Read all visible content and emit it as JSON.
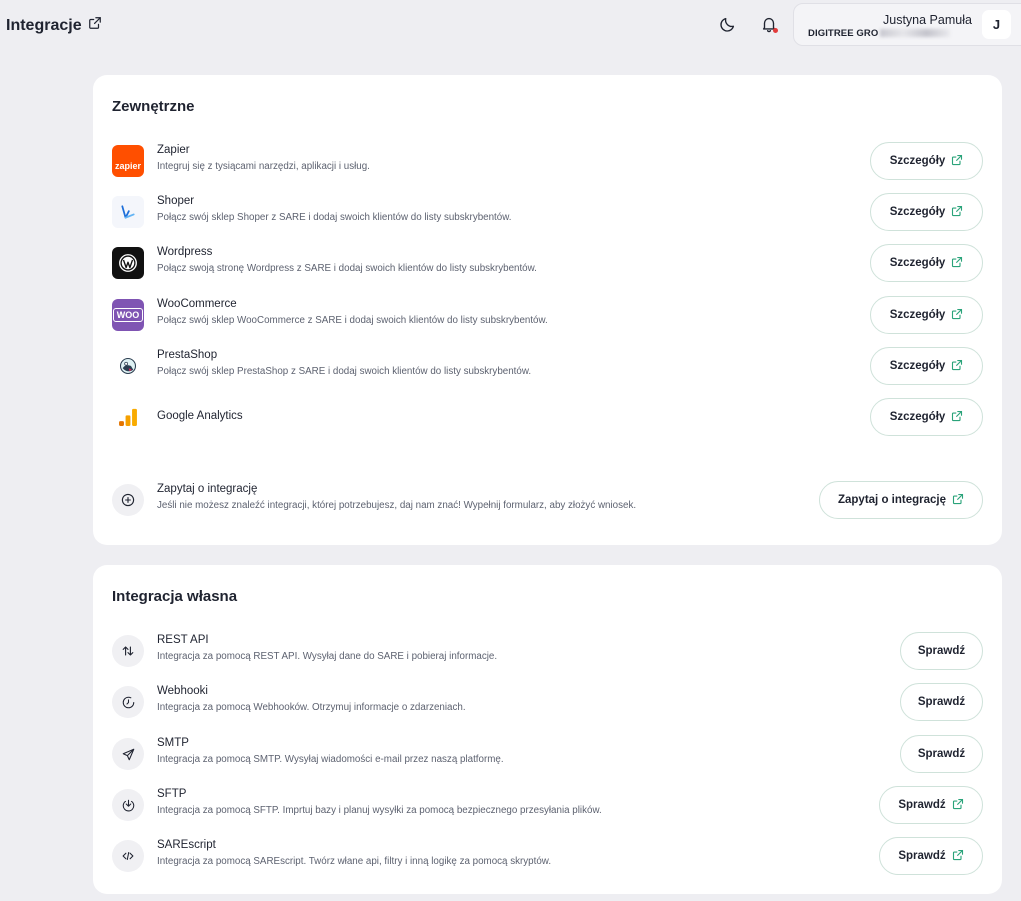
{
  "header": {
    "title": "Integracje",
    "user_name": "Justyna Pamuła",
    "user_org": "DIGITREE GRO",
    "avatar_letter": "J"
  },
  "external": {
    "title": "Zewnętrzne",
    "button_label": "Szczegóły",
    "items": [
      {
        "name": "Zapier",
        "desc": "Integruj się z tysiącami narzędzi, aplikacji i usług.",
        "icon": "zapier-logo",
        "logo_text": "zapier"
      },
      {
        "name": "Shoper",
        "desc": "Połącz swój sklep Shoper z SARE i dodaj swoich klientów do listy subskrybentów.",
        "icon": "shoper-logo"
      },
      {
        "name": "Wordpress",
        "desc": "Połącz swoją stronę Wordpress z SARE i dodaj swoich klientów do listy subskrybentów.",
        "icon": "wordpress-logo"
      },
      {
        "name": "WooCommerce",
        "desc": "Połącz swój sklep WooCommerce z SARE i dodaj swoich klientów do listy subskrybentów.",
        "icon": "woocommerce-logo",
        "logo_text": "WOO"
      },
      {
        "name": "PrestaShop",
        "desc": "Połącz swój sklep PrestaShop z SARE i dodaj swoich klientów do listy subskrybentów.",
        "icon": "prestashop-logo"
      },
      {
        "name": "Google Analytics",
        "desc": "",
        "icon": "google-analytics-logo"
      }
    ],
    "request": {
      "name": "Zapytaj o integrację",
      "desc": "Jeśli nie możesz znaleźć integracji, której potrzebujesz, daj nam znać! Wypełnij formularz, aby złożyć wniosek.",
      "button_label": "Zapytaj o integrację",
      "icon": "plus-circle-icon"
    }
  },
  "own": {
    "title": "Integracja własna",
    "button_label": "Sprawdź",
    "items": [
      {
        "name": "REST API",
        "desc": "Integracja za pomocą REST API. Wysyłaj dane do SARE i pobieraj informacje.",
        "icon": "arrows-up-down-icon",
        "external": false
      },
      {
        "name": "Webhooki",
        "desc": "Integracja za pomocą Webhooków. Otrzymuj informacje o zdarzeniach.",
        "icon": "clock-icon",
        "external": false
      },
      {
        "name": "SMTP",
        "desc": "Integracja za pomocą SMTP. Wysyłaj wiadomości e-mail przez naszą platformę.",
        "icon": "send-icon",
        "external": false
      },
      {
        "name": "SFTP",
        "desc": "Integracja za pomocą SFTP. Imprtuj bazy i planuj wysyłki za pomocą bezpiecznego przesyłania plików.",
        "icon": "download-circle-icon",
        "external": true
      },
      {
        "name": "SAREscript",
        "desc": "Integracja za pomocą SAREscript. Twórz włane api, filtry i inną logikę za pomocą skryptów.",
        "icon": "code-icon",
        "external": true
      }
    ]
  },
  "colors": {
    "accent_green": "#2aa37a",
    "zapier": "#ff4f00",
    "woocommerce": "#7f54b3",
    "analytics_orange": "#f9ab00",
    "notification": "#e23b3b"
  }
}
